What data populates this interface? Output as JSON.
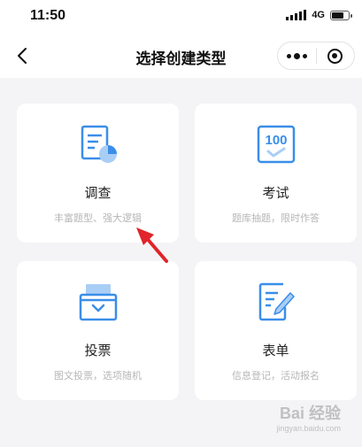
{
  "status_bar": {
    "time": "11:50",
    "network": "4G"
  },
  "nav": {
    "title": "选择创建类型"
  },
  "cards": [
    {
      "title": "调查",
      "subtitle": "丰富题型、强大逻辑",
      "icon": "survey-doc-chart-icon"
    },
    {
      "title": "考试",
      "subtitle": "题库抽题，限时作答",
      "icon": "exam-score-100-icon"
    },
    {
      "title": "投票",
      "subtitle": "图文投票，选项随机",
      "icon": "vote-ballot-box-icon"
    },
    {
      "title": "表单",
      "subtitle": "信息登记，活动报名",
      "icon": "form-edit-doc-icon"
    }
  ],
  "watermark": {
    "brand": "Bai 经验",
    "url": "jingyan.baidu.com"
  },
  "colors": {
    "accent": "#3a8ee8",
    "accent_light": "#a9cef6",
    "annotation": "#e0242a"
  }
}
